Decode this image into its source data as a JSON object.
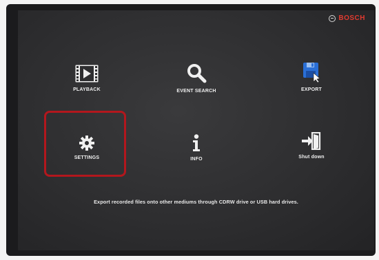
{
  "brand": {
    "name": "BOSCH",
    "logo_icon": "bosch-armature-icon"
  },
  "menu": {
    "items": [
      {
        "label": "PLAYBACK",
        "icon": "film-play-icon"
      },
      {
        "label": "EVENT SEARCH",
        "icon": "search-icon"
      },
      {
        "label": "EXPORT",
        "icon": "floppy-disk-icon"
      },
      {
        "label": "SETTINGS",
        "icon": "gear-icon"
      },
      {
        "label": "INFO",
        "icon": "info-icon"
      },
      {
        "label": "Shut down",
        "icon": "exit-door-icon"
      }
    ],
    "selected_index": 3
  },
  "hint_text": "Export recorded files onto other mediums through CDRW drive or USB hard drives.",
  "colors": {
    "brand": "#e23a2f",
    "highlight": "#b3171d",
    "screen_bg": "#2e2e30",
    "text": "#f0f0f0",
    "export_icon": "#2a6fd6"
  }
}
